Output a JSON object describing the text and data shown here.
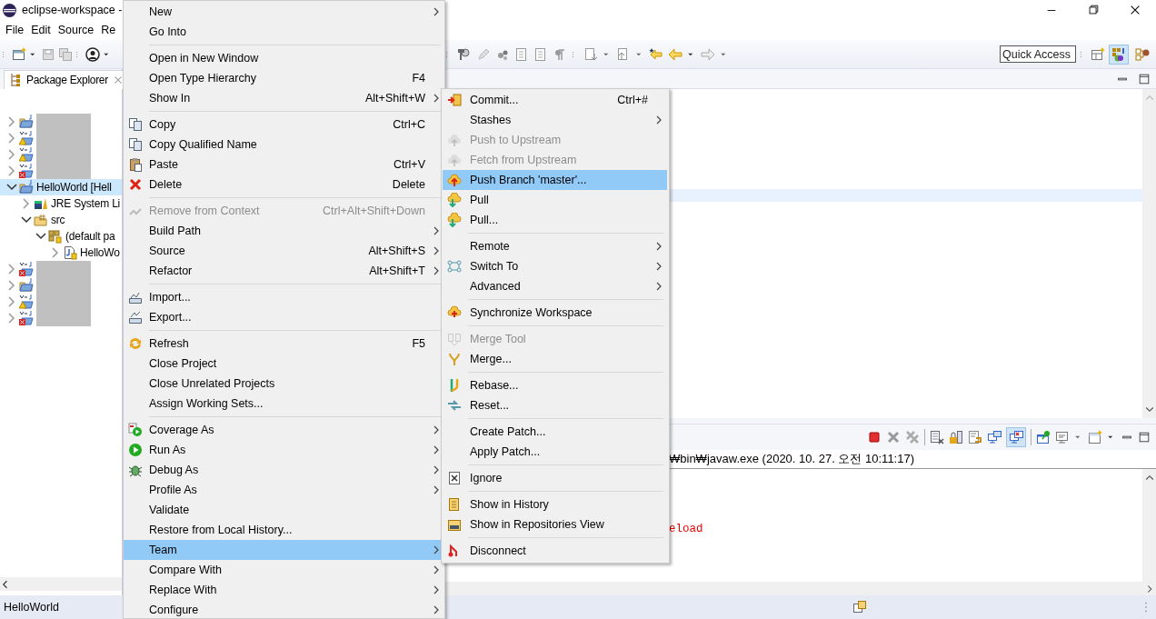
{
  "window": {
    "title": "eclipse-workspace -"
  },
  "menu_bar": [
    "File",
    "Edit",
    "Source",
    "Re"
  ],
  "toolbar": {
    "quick_access": {
      "placeholder": "Quick Access"
    },
    "perspectives": [
      {
        "selected": true
      },
      {
        "selected": false
      }
    ]
  },
  "package_explorer": {
    "tab": "Package Explorer",
    "tree": [
      {
        "kind": "project",
        "redacted": true,
        "expanded": false,
        "selected": false
      },
      {
        "kind": "maven-warning",
        "redacted": true,
        "expanded": false,
        "selected": false
      },
      {
        "kind": "maven-warning",
        "redacted": true,
        "expanded": false,
        "selected": false
      },
      {
        "kind": "maven-error",
        "redacted": true,
        "expanded": false,
        "selected": false
      },
      {
        "kind": "project",
        "label": "HelloWorld [Hell",
        "expanded": true,
        "selected": true,
        "children": [
          {
            "kind": "library",
            "label": "JRE System Li",
            "expanded": false,
            "selected": false
          },
          {
            "kind": "source-folder",
            "label": "src",
            "expanded": true,
            "selected": false,
            "children": [
              {
                "kind": "package",
                "label": "(default pa",
                "expanded": true,
                "selected": false,
                "children": [
                  {
                    "kind": "file",
                    "label": "HelloWo",
                    "expanded": false,
                    "selected": false
                  }
                ]
              }
            ]
          }
        ]
      },
      {
        "kind": "maven-error",
        "redacted": true,
        "expanded": false,
        "selected": false
      },
      {
        "kind": "project",
        "redacted": true,
        "expanded": false,
        "selected": false
      },
      {
        "kind": "maven-warning",
        "redacted": true,
        "expanded": false,
        "selected": false
      },
      {
        "kind": "maven-error",
        "redacted": true,
        "expanded": false,
        "selected": false
      }
    ]
  },
  "console": {
    "toolbar_toggle": {
      "selected": true
    },
    "header": "₩bin₩javaw.exe (2020. 10. 27. 오전 10:11:17)",
    "lines": [
      "eload"
    ]
  },
  "context_menu": {
    "items": [
      {
        "kind": "item",
        "label": "New",
        "submenu": true,
        "disabled": false,
        "selected": false
      },
      {
        "kind": "item",
        "label": "Go Into",
        "submenu": false,
        "disabled": false,
        "selected": false
      },
      {
        "kind": "separator"
      },
      {
        "kind": "item",
        "label": "Open in New Window",
        "submenu": false,
        "disabled": false,
        "selected": false
      },
      {
        "kind": "item",
        "label": "Open Type Hierarchy",
        "shortcut": "F4",
        "submenu": false,
        "disabled": false,
        "selected": false
      },
      {
        "kind": "item",
        "label": "Show In",
        "shortcut": "Alt+Shift+W",
        "submenu": true,
        "disabled": false,
        "selected": false
      },
      {
        "kind": "separator"
      },
      {
        "kind": "item",
        "label": "Copy",
        "shortcut": "Ctrl+C",
        "submenu": false,
        "disabled": false,
        "selected": false
      },
      {
        "kind": "item",
        "label": "Copy Qualified Name",
        "submenu": false,
        "disabled": false,
        "selected": false
      },
      {
        "kind": "item",
        "label": "Paste",
        "shortcut": "Ctrl+V",
        "submenu": false,
        "disabled": false,
        "selected": false
      },
      {
        "kind": "item",
        "label": "Delete",
        "shortcut": "Delete",
        "submenu": false,
        "disabled": false,
        "selected": false
      },
      {
        "kind": "separator"
      },
      {
        "kind": "item",
        "label": "Remove from Context",
        "shortcut": "Ctrl+Alt+Shift+Down",
        "submenu": false,
        "disabled": true,
        "selected": false
      },
      {
        "kind": "item",
        "label": "Build Path",
        "submenu": true,
        "disabled": false,
        "selected": false
      },
      {
        "kind": "item",
        "label": "Source",
        "shortcut": "Alt+Shift+S",
        "submenu": true,
        "disabled": false,
        "selected": false
      },
      {
        "kind": "item",
        "label": "Refactor",
        "shortcut": "Alt+Shift+T",
        "submenu": true,
        "disabled": false,
        "selected": false
      },
      {
        "kind": "separator"
      },
      {
        "kind": "item",
        "label": "Import...",
        "submenu": false,
        "disabled": false,
        "selected": false
      },
      {
        "kind": "item",
        "label": "Export...",
        "submenu": false,
        "disabled": false,
        "selected": false
      },
      {
        "kind": "separator"
      },
      {
        "kind": "item",
        "label": "Refresh",
        "shortcut": "F5",
        "submenu": false,
        "disabled": false,
        "selected": false
      },
      {
        "kind": "item",
        "label": "Close Project",
        "submenu": false,
        "disabled": false,
        "selected": false
      },
      {
        "kind": "item",
        "label": "Close Unrelated Projects",
        "submenu": false,
        "disabled": false,
        "selected": false
      },
      {
        "kind": "item",
        "label": "Assign Working Sets...",
        "submenu": false,
        "disabled": false,
        "selected": false
      },
      {
        "kind": "separator"
      },
      {
        "kind": "item",
        "label": "Coverage As",
        "submenu": true,
        "disabled": false,
        "selected": false
      },
      {
        "kind": "item",
        "label": "Run As",
        "submenu": true,
        "disabled": false,
        "selected": false
      },
      {
        "kind": "item",
        "label": "Debug As",
        "submenu": true,
        "disabled": false,
        "selected": false
      },
      {
        "kind": "item",
        "label": "Profile As",
        "submenu": true,
        "disabled": false,
        "selected": false
      },
      {
        "kind": "item",
        "label": "Validate",
        "submenu": false,
        "disabled": false,
        "selected": false
      },
      {
        "kind": "item",
        "label": "Restore from Local History...",
        "submenu": false,
        "disabled": false,
        "selected": false
      },
      {
        "kind": "item",
        "label": "Team",
        "submenu": true,
        "disabled": false,
        "selected": true
      },
      {
        "kind": "item",
        "label": "Compare With",
        "submenu": true,
        "disabled": false,
        "selected": false
      },
      {
        "kind": "item",
        "label": "Replace With",
        "submenu": true,
        "disabled": false,
        "selected": false
      },
      {
        "kind": "item",
        "label": "Configure",
        "submenu": true,
        "disabled": false,
        "selected": false
      }
    ]
  },
  "team_submenu": {
    "items": [
      {
        "kind": "item",
        "label": "Commit...",
        "shortcut": "Ctrl+#",
        "submenu": false,
        "disabled": false,
        "selected": false
      },
      {
        "kind": "item",
        "label": "Stashes",
        "submenu": true,
        "disabled": false,
        "selected": false
      },
      {
        "kind": "item",
        "label": "Push to Upstream",
        "submenu": false,
        "disabled": true,
        "selected": false
      },
      {
        "kind": "item",
        "label": "Fetch from Upstream",
        "submenu": false,
        "disabled": true,
        "selected": false
      },
      {
        "kind": "item",
        "label": "Push Branch 'master'...",
        "submenu": false,
        "disabled": false,
        "selected": true
      },
      {
        "kind": "item",
        "label": "Pull",
        "submenu": false,
        "disabled": false,
        "selected": false
      },
      {
        "kind": "item",
        "label": "Pull...",
        "submenu": false,
        "disabled": false,
        "selected": false
      },
      {
        "kind": "separator"
      },
      {
        "kind": "item",
        "label": "Remote",
        "submenu": true,
        "disabled": false,
        "selected": false
      },
      {
        "kind": "item",
        "label": "Switch To",
        "submenu": true,
        "disabled": false,
        "selected": false
      },
      {
        "kind": "item",
        "label": "Advanced",
        "submenu": true,
        "disabled": false,
        "selected": false
      },
      {
        "kind": "separator"
      },
      {
        "kind": "item",
        "label": "Synchronize Workspace",
        "submenu": false,
        "disabled": false,
        "selected": false
      },
      {
        "kind": "separator"
      },
      {
        "kind": "item",
        "label": "Merge Tool",
        "submenu": false,
        "disabled": true,
        "selected": false
      },
      {
        "kind": "item",
        "label": "Merge...",
        "submenu": false,
        "disabled": false,
        "selected": false
      },
      {
        "kind": "separator"
      },
      {
        "kind": "item",
        "label": "Rebase...",
        "submenu": false,
        "disabled": false,
        "selected": false
      },
      {
        "kind": "item",
        "label": "Reset...",
        "submenu": false,
        "disabled": false,
        "selected": false
      },
      {
        "kind": "separator"
      },
      {
        "kind": "item",
        "label": "Create Patch...",
        "submenu": false,
        "disabled": false,
        "selected": false
      },
      {
        "kind": "item",
        "label": "Apply Patch...",
        "submenu": false,
        "disabled": false,
        "selected": false
      },
      {
        "kind": "separator"
      },
      {
        "kind": "item",
        "label": "Ignore",
        "submenu": false,
        "disabled": false,
        "selected": false
      },
      {
        "kind": "separator"
      },
      {
        "kind": "item",
        "label": "Show in History",
        "submenu": false,
        "disabled": false,
        "selected": false
      },
      {
        "kind": "item",
        "label": "Show in Repositories View",
        "submenu": false,
        "disabled": false,
        "selected": false
      },
      {
        "kind": "separator"
      },
      {
        "kind": "item",
        "label": "Disconnect",
        "submenu": false,
        "disabled": false,
        "selected": false
      }
    ]
  },
  "status_bar": {
    "text": "HelloWorld"
  }
}
